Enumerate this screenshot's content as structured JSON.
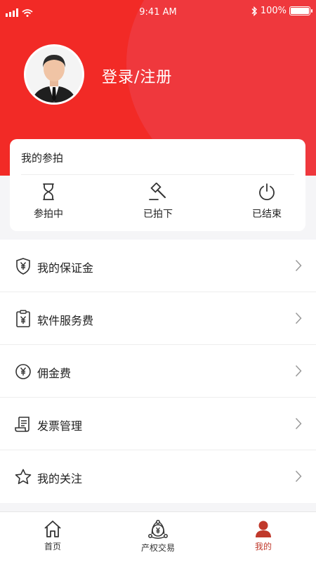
{
  "status_bar": {
    "time": "9:41 AM",
    "battery": "100%"
  },
  "header": {
    "login_label": "登录/注册"
  },
  "my_auctions": {
    "title": "我的参拍",
    "items": [
      {
        "label": "参拍中",
        "icon": "hourglass-icon"
      },
      {
        "label": "已拍下",
        "icon": "gavel-icon"
      },
      {
        "label": "已结束",
        "icon": "power-icon"
      }
    ]
  },
  "menu": {
    "items": [
      {
        "label": "我的保证金",
        "icon": "shield-yen-icon"
      },
      {
        "label": "软件服务费",
        "icon": "clipboard-yen-icon"
      },
      {
        "label": "佣金费",
        "icon": "yen-circle-icon"
      },
      {
        "label": "发票管理",
        "icon": "invoice-scroll-icon"
      },
      {
        "label": "我的关注",
        "icon": "star-icon"
      }
    ]
  },
  "tabbar": {
    "items": [
      {
        "label": "首页",
        "icon": "home-icon",
        "active": false
      },
      {
        "label": "产权交易",
        "icon": "exchange-icon",
        "active": false
      },
      {
        "label": "我的",
        "icon": "user-icon",
        "active": true
      }
    ]
  },
  "colors": {
    "primary": "#f22a26",
    "active_tab": "#c0392b"
  }
}
